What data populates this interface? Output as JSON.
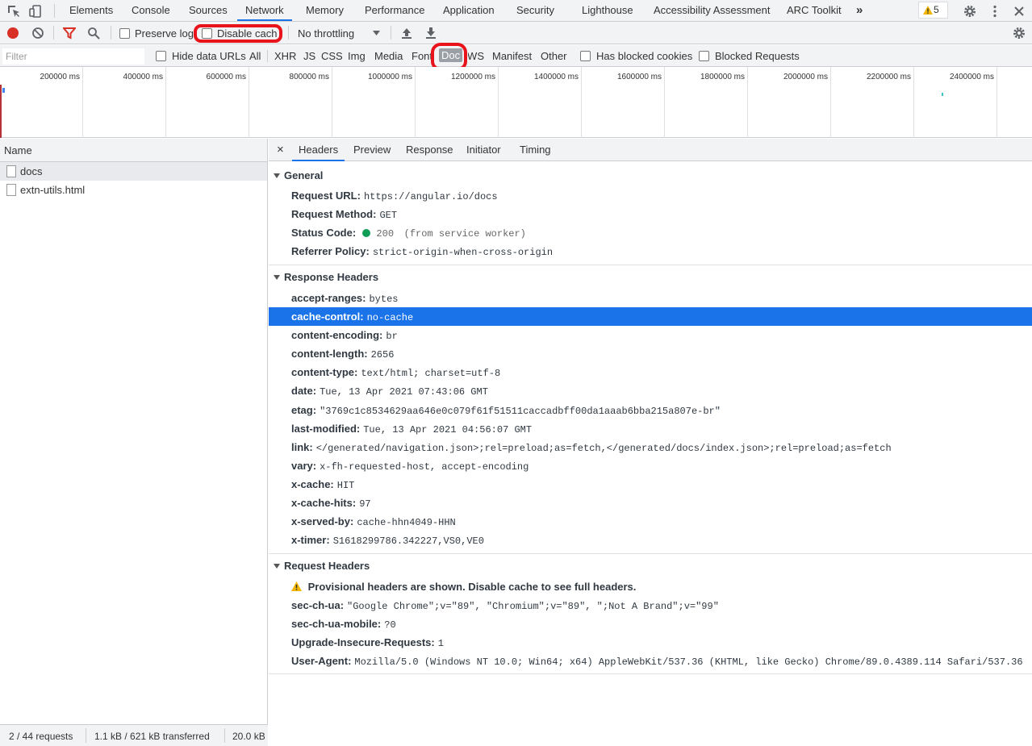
{
  "tabs": {
    "items": [
      "Elements",
      "Console",
      "Sources",
      "Network",
      "Memory",
      "Performance",
      "Application",
      "Security",
      "Lighthouse",
      "Accessibility Assessment",
      "ARC Toolkit"
    ],
    "overflow": "»",
    "warnings_count": "5"
  },
  "toolbar": {
    "preserve_log": "Preserve log",
    "disable_cache": "Disable cache",
    "throttling": "No throttling"
  },
  "filterbar": {
    "filter_placeholder": "Filter",
    "hide_data_urls": "Hide data URLs",
    "types": [
      "All",
      "XHR",
      "JS",
      "CSS",
      "Img",
      "Media",
      "Font",
      "Doc",
      "WS",
      "Manifest",
      "Other"
    ],
    "selected_type": "Doc",
    "has_blocked_cookies": "Has blocked cookies",
    "blocked_requests": "Blocked Requests"
  },
  "overview": {
    "ticks": [
      "200000 ms",
      "400000 ms",
      "600000 ms",
      "800000 ms",
      "1000000 ms",
      "1200000 ms",
      "1400000 ms",
      "1600000 ms",
      "1800000 ms",
      "2000000 ms",
      "2200000 ms",
      "2400000 ms"
    ]
  },
  "requests": {
    "column_name": "Name",
    "items": [
      "docs",
      "extn-utils.html"
    ]
  },
  "statusbar": {
    "requests": "2 / 44 requests",
    "transferred": "1.1 kB / 621 kB transferred",
    "resources": "20.0 kB"
  },
  "detail": {
    "close": "×",
    "tabs": [
      "Headers",
      "Preview",
      "Response",
      "Initiator",
      "Timing"
    ],
    "general": {
      "title": "General",
      "request_url_k": "Request URL:",
      "request_url_v": "https://angular.io/docs",
      "request_method_k": "Request Method:",
      "request_method_v": "GET",
      "status_code_k": "Status Code:",
      "status_code_v": "200",
      "status_code_note": "(from service worker)",
      "referrer_policy_k": "Referrer Policy:",
      "referrer_policy_v": "strict-origin-when-cross-origin"
    },
    "response_headers": {
      "title": "Response Headers",
      "rows": [
        {
          "k": "accept-ranges:",
          "v": "bytes"
        },
        {
          "k": "cache-control:",
          "v": "no-cache"
        },
        {
          "k": "content-encoding:",
          "v": "br"
        },
        {
          "k": "content-length:",
          "v": "2656"
        },
        {
          "k": "content-type:",
          "v": "text/html; charset=utf-8"
        },
        {
          "k": "date:",
          "v": "Tue, 13 Apr 2021 07:43:06 GMT"
        },
        {
          "k": "etag:",
          "v": "\"3769c1c8534629aa646e0c079f61f51511caccadbff00da1aaab6bba215a807e-br\""
        },
        {
          "k": "last-modified:",
          "v": "Tue, 13 Apr 2021 04:56:07 GMT"
        },
        {
          "k": "link:",
          "v": "</generated/navigation.json>;rel=preload;as=fetch,</generated/docs/index.json>;rel=preload;as=fetch"
        },
        {
          "k": "vary:",
          "v": "x-fh-requested-host, accept-encoding"
        },
        {
          "k": "x-cache:",
          "v": "HIT"
        },
        {
          "k": "x-cache-hits:",
          "v": "97"
        },
        {
          "k": "x-served-by:",
          "v": "cache-hhn4049-HHN"
        },
        {
          "k": "x-timer:",
          "v": "S1618299786.342227,VS0,VE0"
        }
      ]
    },
    "request_headers": {
      "title": "Request Headers",
      "provisional_warning": "Provisional headers are shown. Disable cache to see full headers.",
      "rows": [
        {
          "k": "sec-ch-ua:",
          "v": "\"Google Chrome\";v=\"89\", \"Chromium\";v=\"89\", \";Not A Brand\";v=\"99\""
        },
        {
          "k": "sec-ch-ua-mobile:",
          "v": "?0"
        },
        {
          "k": "Upgrade-Insecure-Requests:",
          "v": "1"
        },
        {
          "k": "User-Agent:",
          "v": "Mozilla/5.0 (Windows NT 10.0; Win64; x64) AppleWebKit/537.36 (KHTML, like Gecko) Chrome/89.0.4389.114 Safari/537.36"
        }
      ]
    }
  },
  "colors": {
    "accent": "#1a73e8",
    "record_red": "#d93025",
    "status_green": "#0f9d58",
    "annotation_red": "#e8131b",
    "warning_yellow": "#f2b600"
  }
}
